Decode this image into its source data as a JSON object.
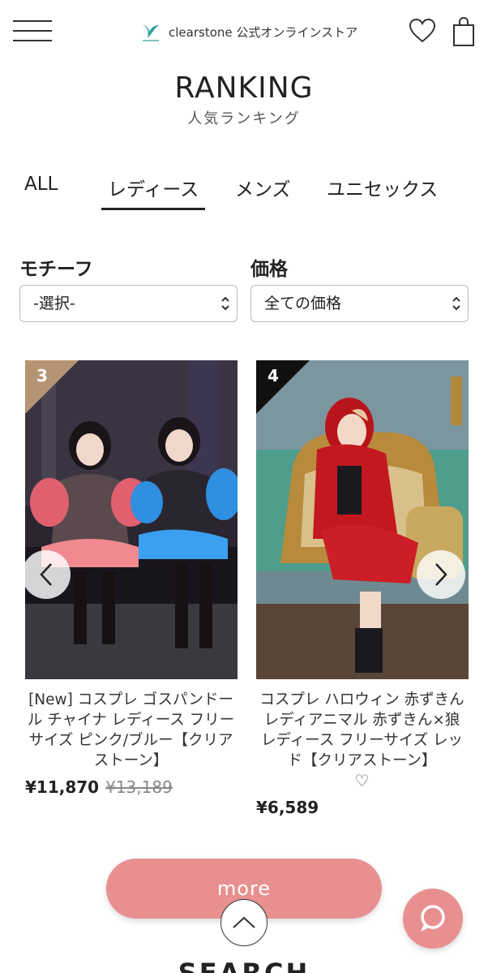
{
  "header": {
    "brand": "clearstone 公式オンラインストア",
    "icons": [
      "hamburger-menu-icon",
      "clearstone-logo-icon",
      "heart-icon",
      "shopping-bag-icon"
    ]
  },
  "ranking": {
    "title": "RANKING",
    "subtitle": "人気ランキング"
  },
  "tabs": [
    {
      "label": "ALL"
    },
    {
      "label": "レディース",
      "active": true
    },
    {
      "label": "メンズ"
    },
    {
      "label": "ユニセックス"
    }
  ],
  "filters": {
    "motif": {
      "label": "モチーフ",
      "value": "-選択-"
    },
    "price": {
      "label": "価格",
      "value": "全ての価格"
    }
  },
  "products": [
    {
      "rank": "3",
      "badge_color": "#b59473",
      "name": "[New] コスプレ ゴスパンドール チャイナ レディース フリーサイズ ピンク/ブルー【クリアストーン】",
      "price": "¥11,870",
      "old_price": "¥13,189"
    },
    {
      "rank": "4",
      "badge_color": "#111111",
      "name": "コスプレ ハロウィン 赤ずきん レディアニマル 赤ずきん×狼 レディース フリーサイズ レッド【クリアストーン】",
      "fav": "♡",
      "price": "¥6,589"
    }
  ],
  "buttons": {
    "more": "more"
  },
  "footer": {
    "search_heading": "SEARCH"
  },
  "colors": {
    "accent": "#e89090"
  }
}
